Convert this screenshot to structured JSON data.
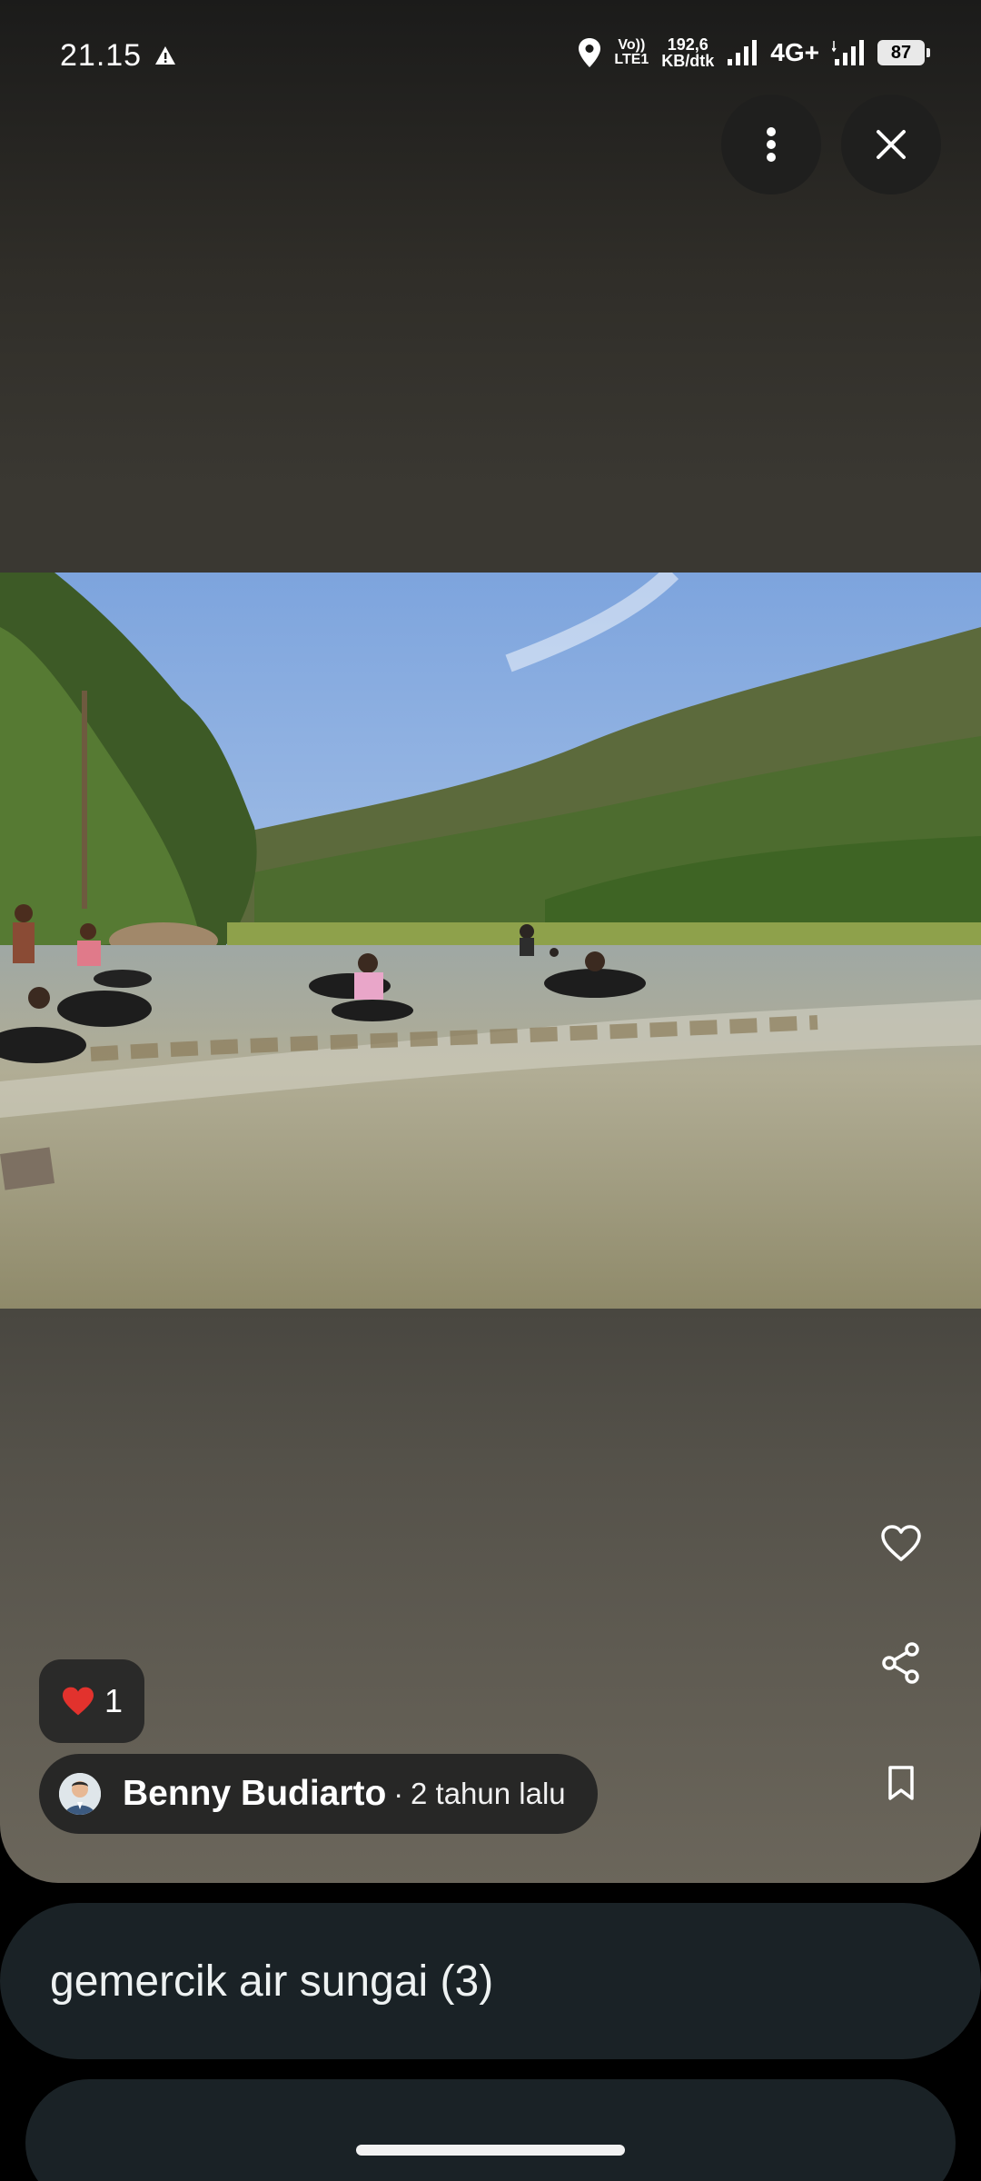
{
  "status_bar": {
    "time": "21.15",
    "volte_top": "Vo))",
    "volte_bottom": "LTE1",
    "speed_value": "192,6",
    "speed_unit": "KB/dtk",
    "network": "4G+",
    "battery": "87",
    "icons": [
      "warning-icon",
      "location-icon",
      "signal-icon",
      "signal-icon"
    ]
  },
  "toolbar": {
    "more_icon": "more-vertical-icon",
    "close_icon": "close-icon"
  },
  "actions": {
    "like_icon": "heart-outline-icon",
    "share_icon": "share-icon",
    "save_icon": "bookmark-icon"
  },
  "reactions": {
    "emoji": "❤️",
    "count": "1"
  },
  "author": {
    "name": "Benny Budiarto",
    "separator": "·",
    "time": "2 tahun lalu"
  },
  "album": {
    "title": "gemercik air sungai (3)"
  }
}
